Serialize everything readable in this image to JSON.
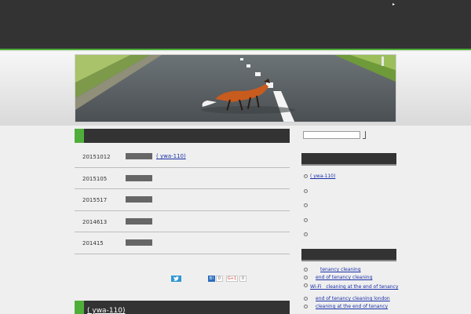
{
  "topbar": {
    "play_glyph": "▸"
  },
  "main": {
    "section_title": "",
    "news": [
      {
        "date": "20151012",
        "link": "( ywa-110)"
      },
      {
        "date": "2015105",
        "link": ""
      },
      {
        "date": "2015517",
        "link": ""
      },
      {
        "date": "2014613",
        "link": ""
      },
      {
        "date": "201415",
        "link": ""
      }
    ],
    "share": {
      "twitter_icon": "twitter-bird",
      "hatena_icon": "B!",
      "hatena_count": "0",
      "gplus_label": "G+1",
      "gplus_count": "0"
    }
  },
  "main2": {
    "section_title": "( ywa-110)"
  },
  "sidebar": {
    "search_placeholder": "",
    "list1": [
      "( ywa-110)",
      "",
      "",
      "",
      ""
    ],
    "list2": [
      "tenancy cleaning",
      "end of tenancy cleaning",
      "Wi-Fi　cleaning at the end of tenancy",
      "end of tenancy cleaning london",
      "cleaning at the end of tenancy"
    ]
  },
  "colors": {
    "accent": "#4fae3a",
    "dark": "#333333",
    "link": "#1a2fa8"
  }
}
